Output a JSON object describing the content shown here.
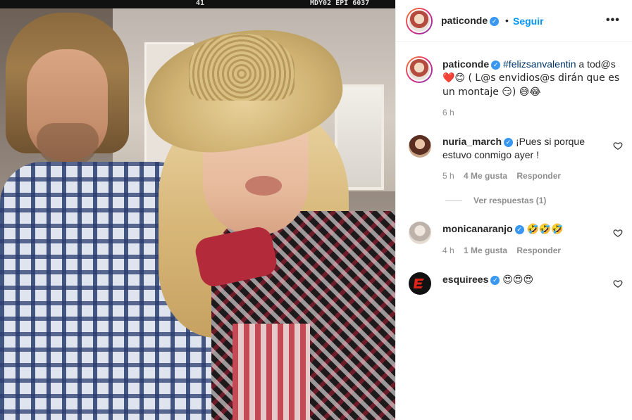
{
  "media": {
    "film_number": "41",
    "film_code": "MDY02 EPI 6037"
  },
  "header": {
    "username": "paticonde",
    "dot": "•",
    "follow_label": "Seguir",
    "more_label": "•••"
  },
  "caption": {
    "username": "paticonde",
    "hashtag": "#felizsanvalentin",
    "line1_rest": " a tod@s",
    "line2": "❤️😊 ( L@s envidios@s dirán que es",
    "line3": "un montaje 😏) 😅😂",
    "time": "6 h"
  },
  "comments": [
    {
      "username": "nuria_march",
      "text_line1": "¡Pues si porque",
      "text_line2": "estuvo conmigo ayer !",
      "time": "5 h",
      "likes": "4 Me gusta",
      "reply": "Responder",
      "replies_label": "Ver respuestas (1)"
    },
    {
      "username": "monicanaranjo",
      "text": "🤣🤣🤣",
      "time": "4 h",
      "likes": "1 Me gusta",
      "reply": "Responder"
    },
    {
      "username": "esquirees",
      "text": "😍😍😍"
    }
  ],
  "colors": {
    "link_blue": "#0095f6",
    "verified_blue": "#3897f0",
    "muted": "#8e8e8e"
  }
}
